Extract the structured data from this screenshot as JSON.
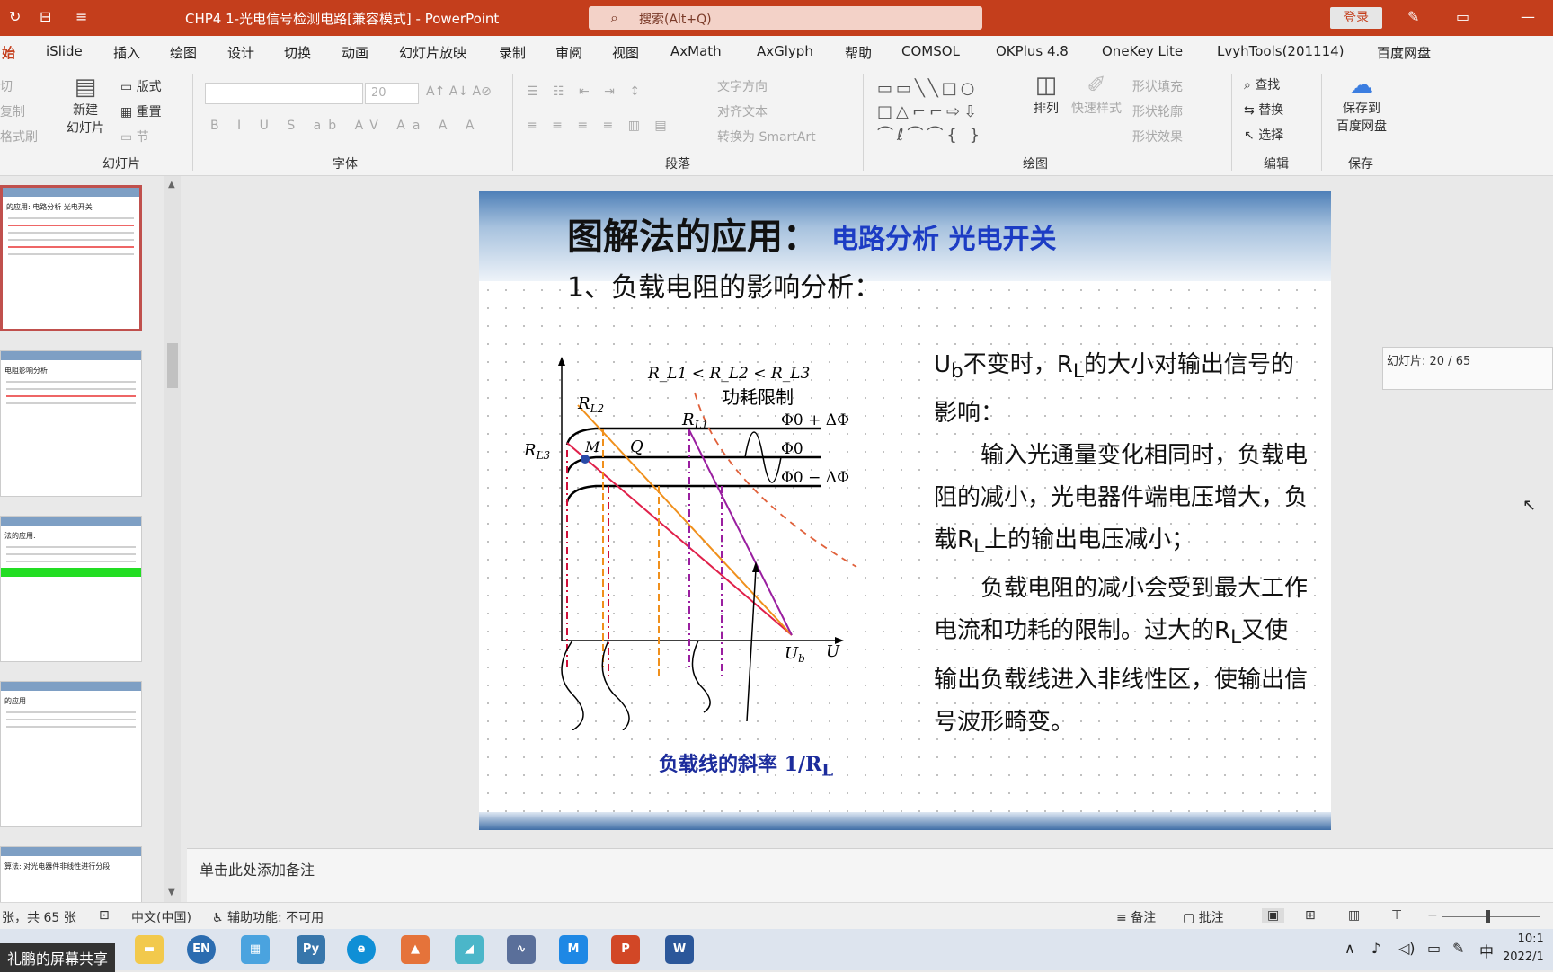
{
  "window": {
    "title": "CHP4 1-光电信号检测电路[兼容模式]  -  PowerPoint",
    "search_placeholder": "搜索(Alt+Q)",
    "login": "登录"
  },
  "tabs": [
    "始",
    "iSlide",
    "插入",
    "绘图",
    "设计",
    "切换",
    "动画",
    "幻灯片放映",
    "录制",
    "审阅",
    "视图",
    "AxMath",
    "AxGlyph",
    "帮助",
    "COMSOL",
    "OKPlus 4.8",
    "OneKey Lite",
    "LvyhTools(201114)",
    "百度网盘"
  ],
  "ribbon": {
    "clipboard_fragments": [
      "切",
      "复制",
      "格式刷"
    ],
    "slides_group": {
      "new_slide": "新建",
      "new_slide2": "幻灯片",
      "layout": "版式",
      "reset": "重置",
      "section": "节",
      "label": "幻灯片"
    },
    "font_group": {
      "size": "20",
      "label": "字体"
    },
    "paragraph_group": {
      "text_direction": "文字方向",
      "align_text": "对齐文本",
      "convert_smartart": "转换为 SmartArt",
      "label": "段落"
    },
    "drawing_group": {
      "arrange": "排列",
      "quick_styles": "快速样式",
      "shape_fill": "形状填充",
      "shape_outline": "形状轮廓",
      "shape_effects": "形状效果",
      "label": "绘图"
    },
    "editing_group": {
      "find": "查找",
      "replace": "替换",
      "select": "选择",
      "label": "编辑"
    },
    "save_group": {
      "save_to": "保存到",
      "baidu": "百度网盘",
      "label": "保存"
    }
  },
  "thumbnails": [
    {
      "title": "的应用:  电路分析  光电开关",
      "active": true
    },
    {
      "title": "电阻影响分析",
      "active": false
    },
    {
      "title": "法的应用:",
      "active": false
    },
    {
      "title": "的应用",
      "active": false
    },
    {
      "title": "算法: 对光电器件非线性进行分段",
      "active": false
    }
  ],
  "slide": {
    "title": "图解法的应用：",
    "subtitle": "电路分析 光电开关",
    "heading": "1、负载电阻的影响分析：",
    "para1_pre": "U",
    "para1_sub": "b",
    "para1_mid": "不变时，R",
    "para1_sub2": "L",
    "para1_post": "的大小对输出信号的影响：",
    "para2": "输入光通量变化相同时，负载电阻的减小，光电器件端电压增大，负载R",
    "para2_sub": "L",
    "para2_post": "上的输出电压减小；",
    "para3": "负载电阻的减小会受到最大工作电流和功耗的限制。过大的R",
    "para3_sub": "L",
    "para3_post": "又使输出负载线进入非线性区，使输出信号波形畸变。",
    "caption": "负载线的斜率 1/R",
    "caption_sub": "L"
  },
  "diagram": {
    "relation": "R_L1 < R_L2 < R_L3",
    "power_limit": "功耗限制",
    "labels": {
      "rl1": "R",
      "rl1_sub": "L1",
      "rl2": "R",
      "rl2_sub": "L2",
      "rl3": "R",
      "rl3_sub": "L3",
      "m": "M",
      "q": "Q",
      "ub": "U",
      "ub_sub": "b",
      "u": "U"
    },
    "curves": [
      "Φ0 + ΔΦ",
      "Φ0",
      "Φ0 − ΔΦ"
    ]
  },
  "counter": "幻灯片: 20 / 65",
  "notes_placeholder": "单击此处添加备注",
  "status": {
    "slide_info": "张，共 65 张",
    "language": "中文(中国)",
    "accessibility": "辅助功能: 不可用",
    "notes": "备注",
    "comments": "批注"
  },
  "taskbar": {
    "share": "礼鹏的屏幕共享",
    "clock_time": "10:1",
    "clock_date": "2022/1",
    "ime": "中"
  }
}
